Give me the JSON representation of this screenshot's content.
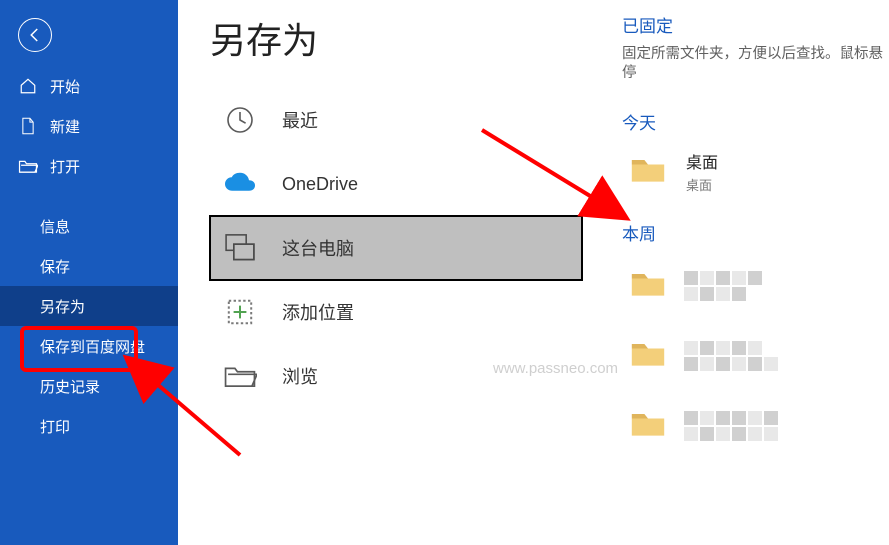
{
  "page_title": "另存为",
  "sidebar": {
    "primary": [
      {
        "label": "开始",
        "icon": "home-icon"
      },
      {
        "label": "新建",
        "icon": "new-file-icon"
      },
      {
        "label": "打开",
        "icon": "open-folder-icon"
      }
    ],
    "secondary": [
      {
        "label": "信息"
      },
      {
        "label": "保存"
      },
      {
        "label": "另存为",
        "selected": true
      },
      {
        "label": "保存到百度网盘"
      },
      {
        "label": "历史记录"
      },
      {
        "label": "打印"
      }
    ]
  },
  "locations": [
    {
      "label": "最近",
      "icon": "clock-icon"
    },
    {
      "label": "OneDrive",
      "icon": "onedrive-icon"
    },
    {
      "label": "这台电脑",
      "icon": "this-pc-icon",
      "selected": true
    },
    {
      "label": "添加位置",
      "icon": "add-location-icon"
    },
    {
      "label": "浏览",
      "icon": "browse-folder-icon"
    }
  ],
  "right": {
    "pinned_head": "已固定",
    "pinned_desc": "固定所需文件夹，方便以后查找。鼠标悬停",
    "today_head": "今天",
    "today": [
      {
        "name": "桌面",
        "path": "桌面"
      }
    ],
    "week_head": "本周"
  },
  "watermark": "www.passneo.com",
  "colors": {
    "brand": "#185abd",
    "annotation": "#ff0000",
    "onedrive": "#1a8fe3",
    "folder_tab": "#e0b55c",
    "folder_body": "#f3cf7a"
  }
}
